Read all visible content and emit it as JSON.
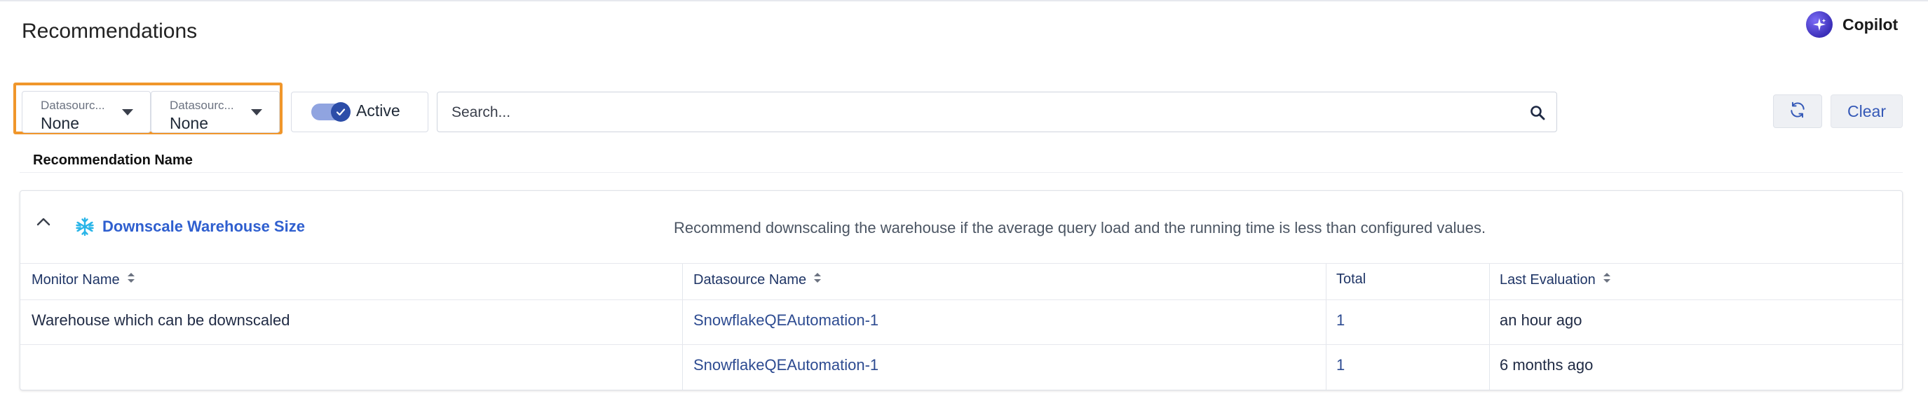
{
  "page": {
    "title": "Recommendations"
  },
  "copilot": {
    "label": "Copilot"
  },
  "filters": {
    "datasource_1": {
      "label": "Datasourc...",
      "value": "None"
    },
    "datasource_2": {
      "label": "Datasourc...",
      "value": "None"
    },
    "active_label": "Active",
    "active_on": true
  },
  "search": {
    "placeholder": "Search..."
  },
  "toolbar": {
    "clear_label": "Clear"
  },
  "list": {
    "column_header": "Recommendation Name"
  },
  "recommendation": {
    "title": "Downscale Warehouse Size",
    "description": "Recommend downscaling the warehouse if the average query load and the running time is less than configured values.",
    "columns": [
      "Monitor Name",
      "Datasource Name",
      "Total",
      "Last Evaluation"
    ],
    "rows": [
      {
        "monitor": "Warehouse which can be downscaled",
        "datasource": "SnowflakeQEAutomation-1",
        "total": "1",
        "last_evaluation": "an hour ago"
      },
      {
        "monitor": "",
        "datasource": "SnowflakeQEAutomation-1",
        "total": "1",
        "last_evaluation": "6 months ago"
      }
    ]
  },
  "colors": {
    "accent": "#2f5fcf",
    "highlight": "#f0962b",
    "toggle": "#2c4da8"
  },
  "icons": [
    "copilot-sparkle-icon",
    "chevron-down-icon",
    "check-icon",
    "search-icon",
    "refresh-icon",
    "chevron-up-icon",
    "snowflake-icon",
    "sort-icon"
  ]
}
